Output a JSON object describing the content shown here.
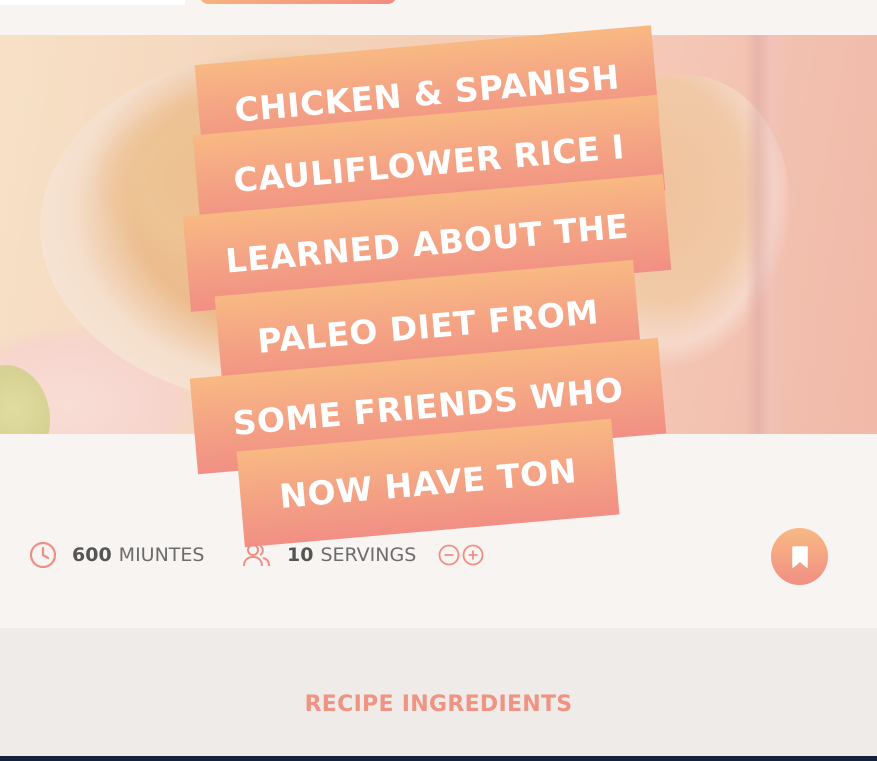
{
  "recipe": {
    "title_lines": [
      "CHICKEN & SPANISH",
      "CAULIFLOWER RICE I",
      "LEARNED ABOUT THE",
      "PALEO DIET FROM",
      "SOME FRIENDS WHO",
      "NOW HAVE TON"
    ],
    "time_value": "600",
    "time_unit": "MIUNTES",
    "servings_value": "10",
    "servings_unit": "SERVINGS"
  },
  "icons": {
    "time": "clock-icon",
    "servings": "people-icon",
    "decrease": "minus-circle-icon",
    "increase": "plus-circle-icon",
    "bookmark": "bookmark-icon"
  },
  "ingredients": {
    "heading": "RECIPE INGREDIENTS"
  },
  "colors": {
    "accent_start": "#f8b983",
    "accent_end": "#f18f84",
    "heading": "#ef9382",
    "page_bg": "#f8f4f2",
    "section_bg": "#efebe9",
    "footer_bar": "#16203b"
  }
}
